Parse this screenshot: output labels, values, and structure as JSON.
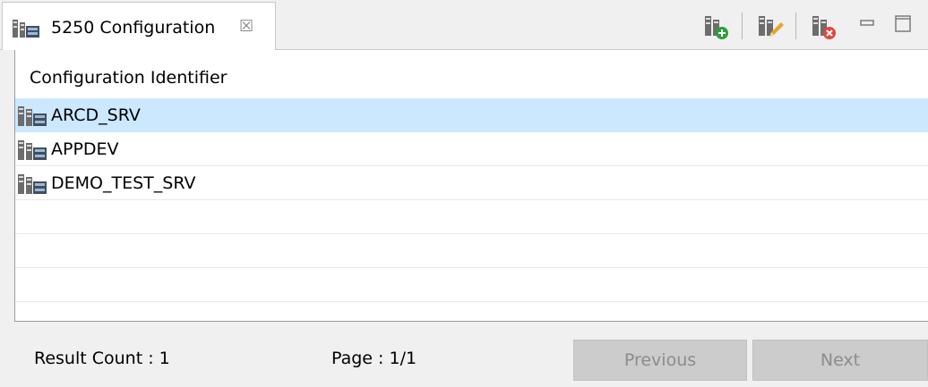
{
  "tab": {
    "title": "5250 Configuration",
    "close_glyph": "☒",
    "icon": "server-config-icon"
  },
  "toolbar": {
    "buttons": [
      {
        "icon": "add-configuration-icon"
      },
      {
        "icon": "edit-configuration-icon"
      },
      {
        "icon": "delete-configuration-icon"
      }
    ],
    "minimize_icon": "minimize-icon",
    "maximize_icon": "maximize-icon"
  },
  "table": {
    "column_header": "Configuration Identifier",
    "rows": [
      {
        "label": "ARCD_SRV",
        "icon": "server-config-icon",
        "selected": true
      },
      {
        "label": "APPDEV",
        "icon": "server-config-icon",
        "selected": false
      },
      {
        "label": "DEMO_TEST_SRV",
        "icon": "server-config-icon",
        "selected": false
      }
    ]
  },
  "footer": {
    "result_count": "Result Count : 1",
    "page": "Page : 1/1",
    "previous_label": "Previous",
    "next_label": "Next"
  },
  "colors": {
    "selection": "#cce8ff",
    "disabled_button": "#cccccc",
    "disabled_text": "#8c8c8c",
    "add_badge": "#2e9e3a",
    "delete_badge": "#e0473c",
    "edit_pencil": "#e8a52a"
  }
}
